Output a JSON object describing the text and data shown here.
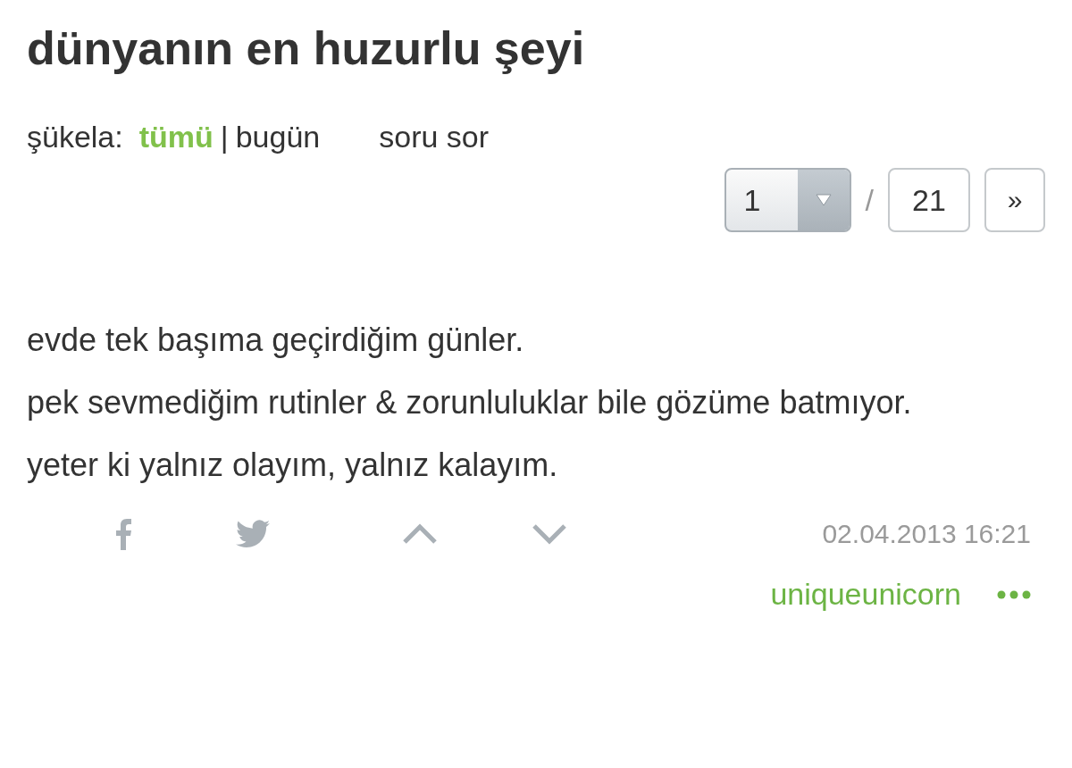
{
  "title": "dünyanın en huzurlu şeyi",
  "filters": {
    "label": "şükela:",
    "separator": "|",
    "options": [
      {
        "label": "tümü",
        "selected": true
      },
      {
        "label": "bugün",
        "selected": false
      }
    ],
    "ask": "soru sor"
  },
  "pager": {
    "current": "1",
    "separator": "/",
    "total": "21",
    "next": "»"
  },
  "entry": {
    "lines": [
      "evde tek başıma geçirdiğim günler.",
      "pek sevmediğim rutinler & zorunluluklar bile gözüme batmıyor.",
      "yeter ki yalnız olayım, yalnız kalayım."
    ],
    "date": "02.04.2013 16:21",
    "author": "uniqueunicorn"
  }
}
